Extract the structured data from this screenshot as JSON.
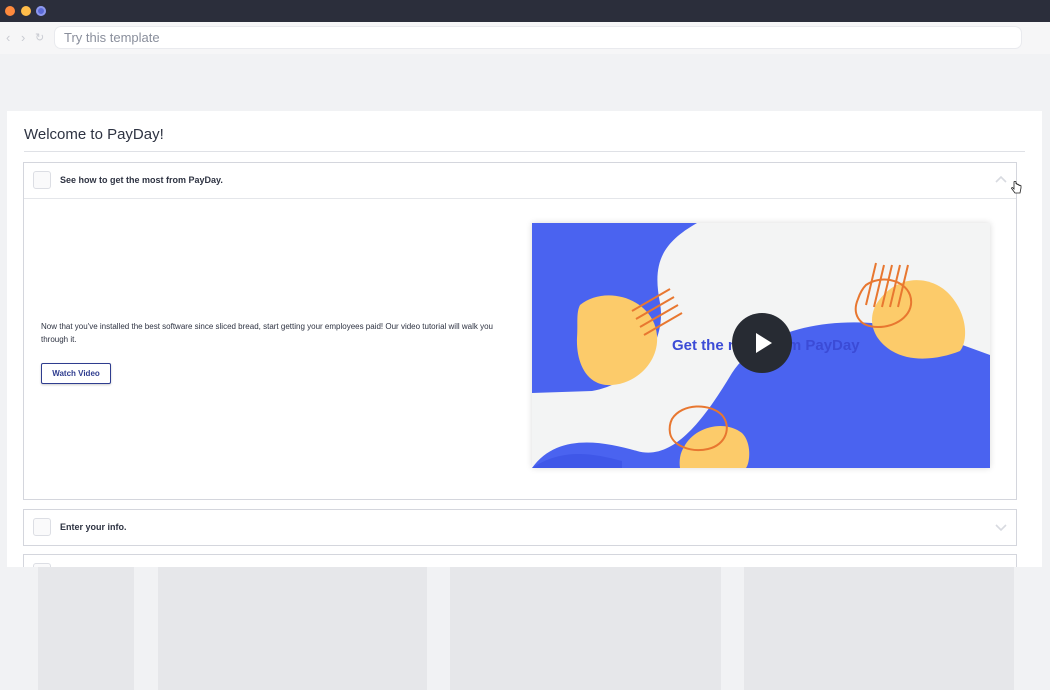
{
  "browser": {
    "address_text": "Try this template",
    "icons": [
      "back-icon",
      "forward-icon",
      "reload-icon"
    ]
  },
  "page": {
    "title": "Welcome to PayDay!"
  },
  "accordion": {
    "items": [
      {
        "label": "See how to get the most from PayDay.",
        "expanded": true,
        "description": "Now that you've installed the best software since sliced bread, start getting your employees paid! Our video tutorial will walk you through it.",
        "button_label": "Watch Video",
        "video_title": "Get the most from PayDay"
      },
      {
        "label": "Enter your info.",
        "expanded": false
      }
    ]
  },
  "colors": {
    "accent": "#3b4bd6",
    "button_border": "#2f3d8f",
    "blob_yellow": "#fccb6a",
    "doodle_orange": "#e87730",
    "titlebar": "#2b2e3b"
  }
}
